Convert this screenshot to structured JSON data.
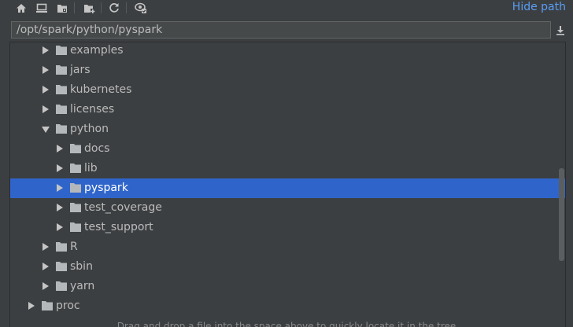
{
  "toolbar": {
    "icons": [
      "home-icon",
      "desktop-icon",
      "project-icon",
      "new-folder-icon",
      "refresh-icon",
      "show-hidden-icon"
    ],
    "hide_path_label": "Hide path"
  },
  "path_field": {
    "value": "/opt/spark/python/pyspark"
  },
  "tree": {
    "rows": [
      {
        "label": "examples",
        "expanded": false,
        "depth": 1
      },
      {
        "label": "jars",
        "expanded": false,
        "depth": 1
      },
      {
        "label": "kubernetes",
        "expanded": false,
        "depth": 1
      },
      {
        "label": "licenses",
        "expanded": false,
        "depth": 1
      },
      {
        "label": "python",
        "expanded": true,
        "depth": 1
      },
      {
        "label": "docs",
        "expanded": false,
        "depth": 2
      },
      {
        "label": "lib",
        "expanded": false,
        "depth": 2
      },
      {
        "label": "pyspark",
        "expanded": false,
        "depth": 2,
        "selected": true
      },
      {
        "label": "test_coverage",
        "expanded": false,
        "depth": 2
      },
      {
        "label": "test_support",
        "expanded": false,
        "depth": 2
      },
      {
        "label": "R",
        "expanded": false,
        "depth": 1
      },
      {
        "label": "sbin",
        "expanded": false,
        "depth": 1
      },
      {
        "label": "yarn",
        "expanded": false,
        "depth": 1
      },
      {
        "label": "proc",
        "expanded": false,
        "depth": 0
      }
    ]
  },
  "hint": "Drag and drop a file into the space above to quickly locate it in the tree",
  "colors": {
    "background": "#3c3f41",
    "selection": "#2f65ca",
    "link": "#589df6",
    "folder": "#b4b8bb"
  }
}
